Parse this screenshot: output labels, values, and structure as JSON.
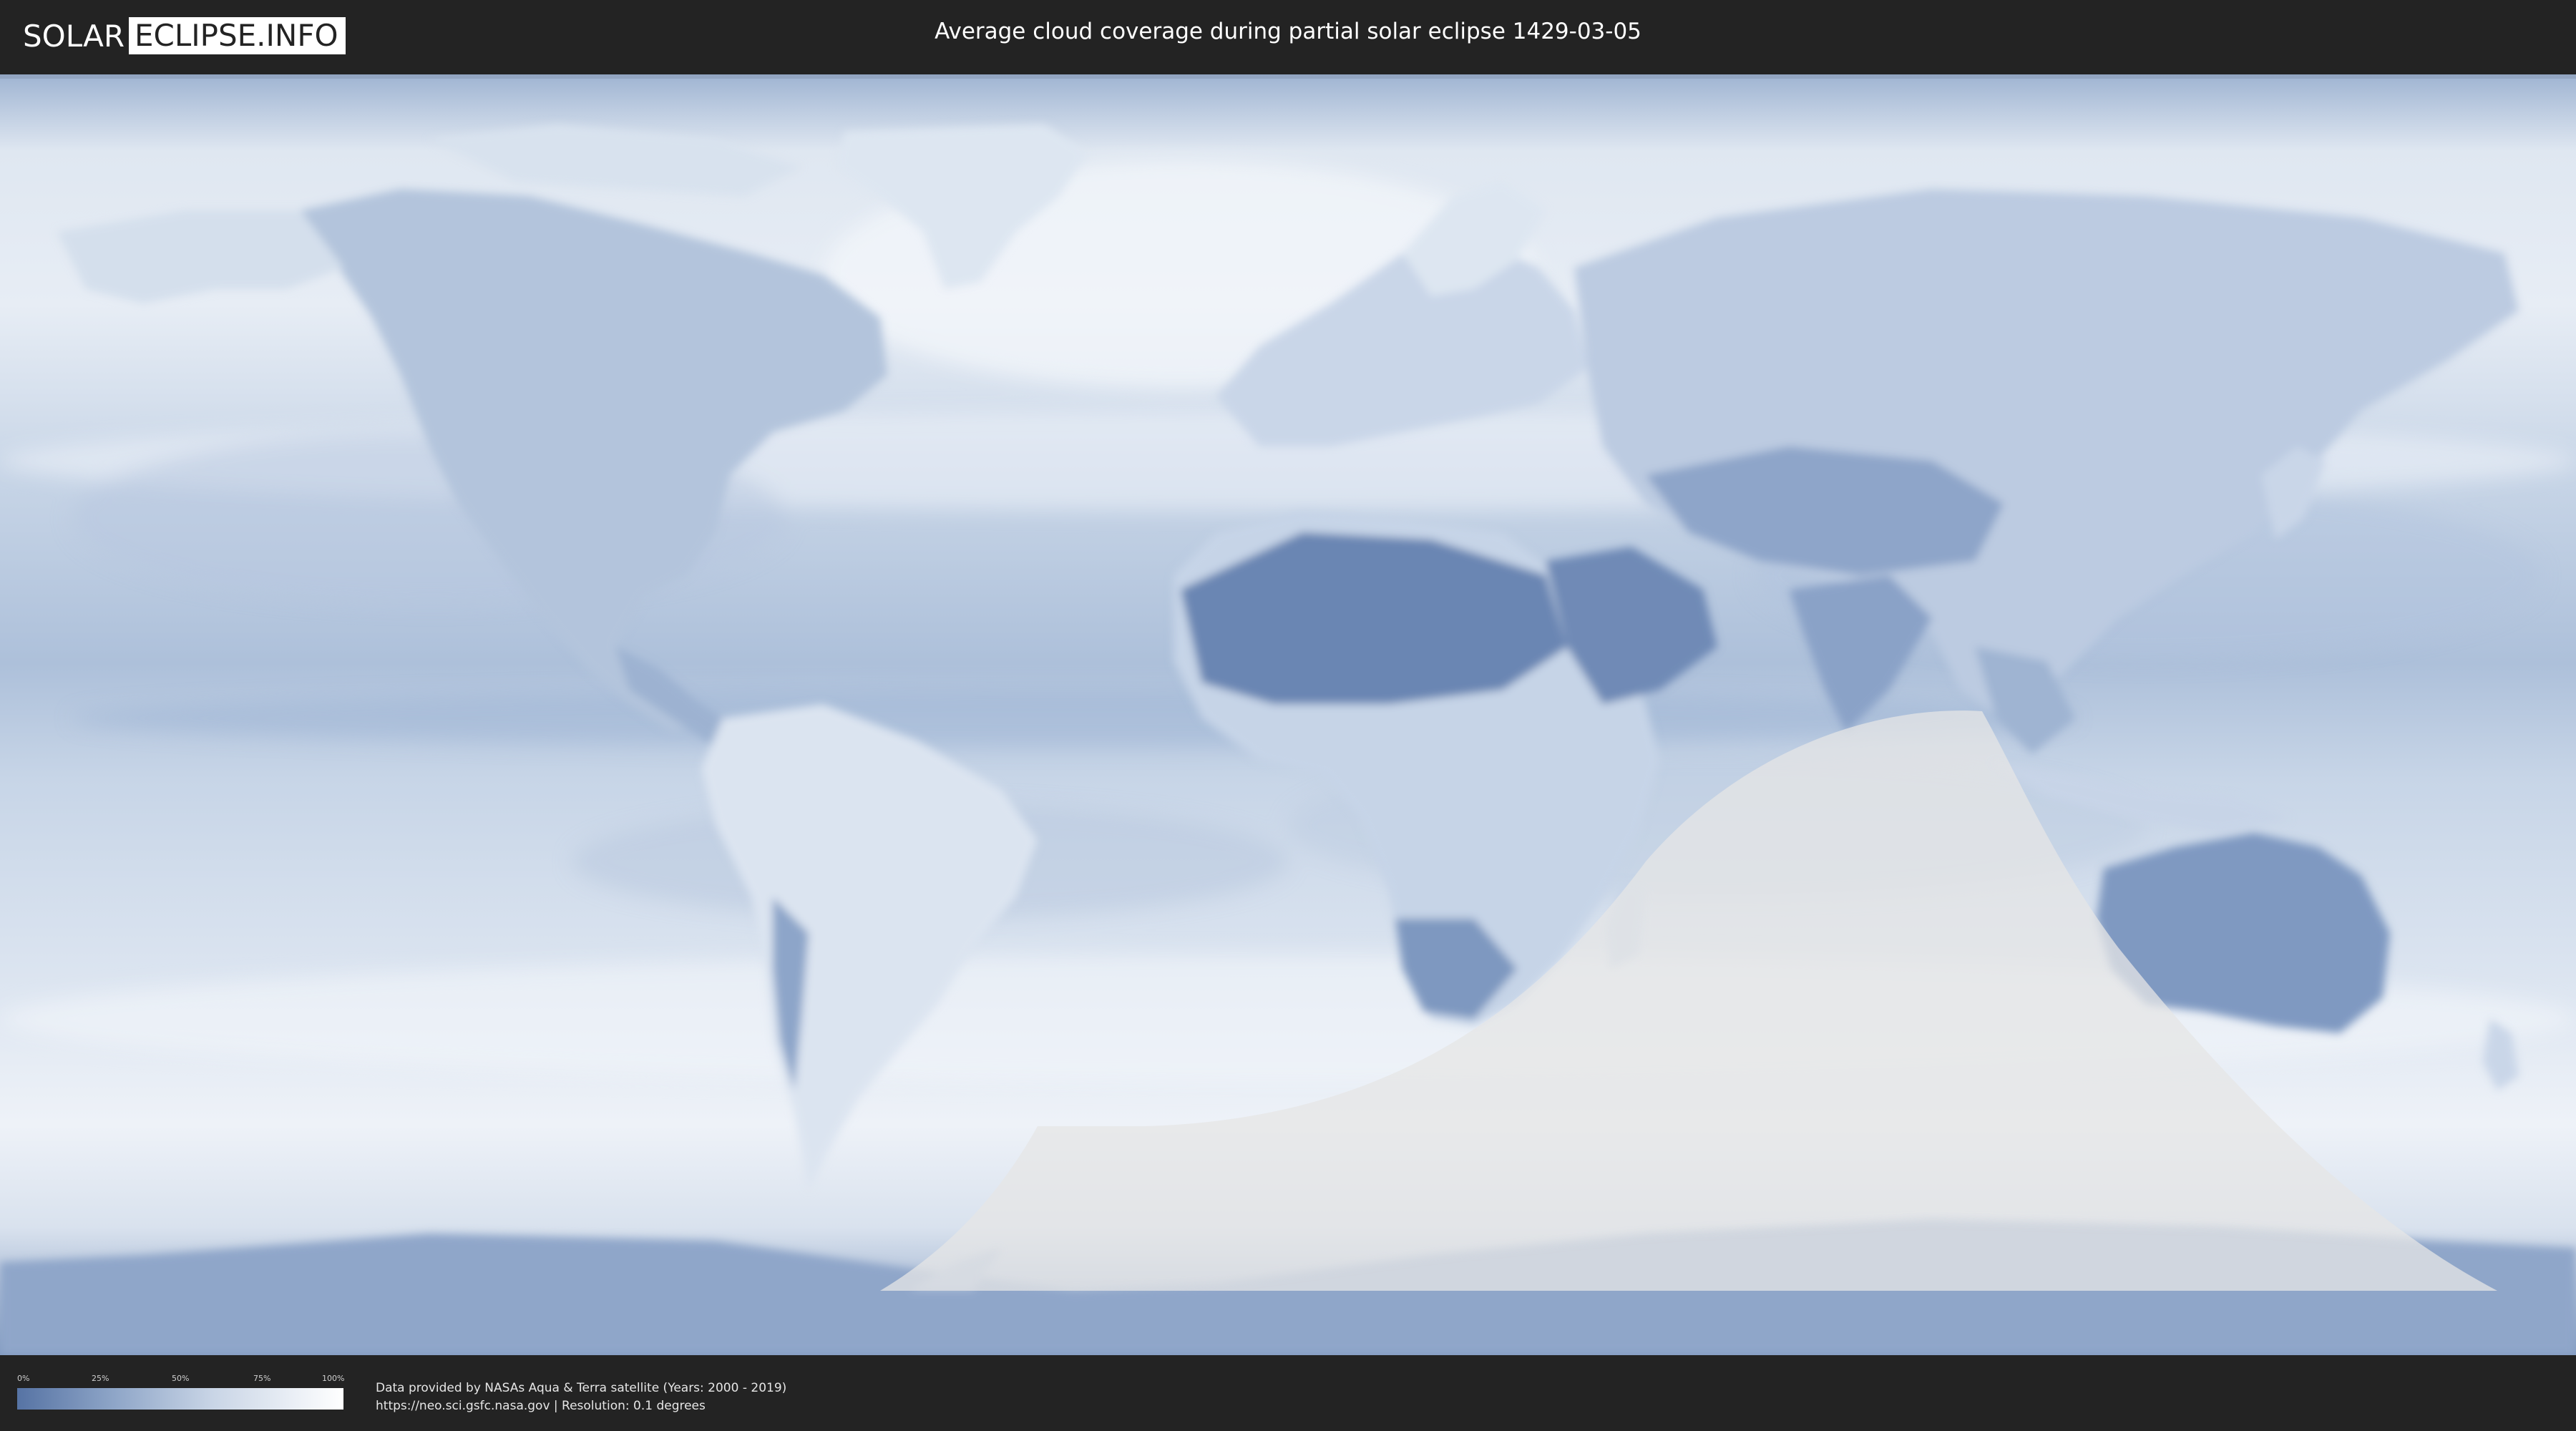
{
  "logo": {
    "left_text": "SOLAR",
    "right_text": "ECLIPSE.INFO"
  },
  "title": "Average cloud coverage during partial solar eclipse 1429-03-05",
  "map": {
    "projection": "equirectangular",
    "layer": "average cloud coverage",
    "eclipse_region_color": "#dcdcdc",
    "ocean_cloud_color": "#c5d4e7",
    "land_clear_color": "#5e7aa9"
  },
  "legend": {
    "ticks": [
      "0%",
      "25%",
      "50%",
      "75%",
      "100%"
    ],
    "gradient_start": "#5673a4",
    "gradient_end": "#ffffff"
  },
  "credits": {
    "line1": "Data provided by NASAs Aqua & Terra satellite (Years: 2000 - 2019)",
    "line2": "https://neo.sci.gsfc.nasa.gov | Resolution: 0.1 degrees"
  }
}
